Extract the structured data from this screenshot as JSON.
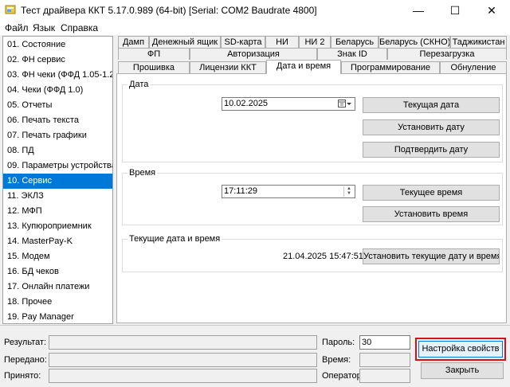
{
  "window": {
    "title": "Тест драйвера ККТ 5.17.0.989 (64-bit) [Serial: COM2 Baudrate 4800]",
    "minimize_glyph": "—",
    "maximize_glyph": "☐",
    "close_glyph": "✕"
  },
  "menu": {
    "file": "Файл",
    "language": "Язык",
    "help": "Справка"
  },
  "sidebar": {
    "items": [
      "01. Состояние",
      "02. ФН сервис",
      "03. ФН чеки (ФФД 1.05-1.2)",
      "04. Чеки (ФФД 1.0)",
      "05. Отчеты",
      "06. Печать текста",
      "07. Печать графики",
      "08. ПД",
      "09. Параметры устройства",
      "10. Сервис",
      "11. ЭКЛЗ",
      "12. МФП",
      "13. Купюроприемник",
      "14. MasterPay-K",
      "15. Модем",
      "16. БД чеков",
      "17. Онлайн платежи",
      "18. Прочее",
      "19. Pay Manager"
    ],
    "selected_index": 9
  },
  "tabs": {
    "row1": [
      "Дамп",
      "Денежный ящик",
      "SD-карта",
      "НИ",
      "НИ 2",
      "Беларусь",
      "Беларусь (СКНО)",
      "Таджикистан"
    ],
    "row2": [
      "ФП",
      "Авторизация",
      "Знак ID",
      "Перезагрузка"
    ],
    "row3": [
      "Прошивка",
      "Лицензии ККТ",
      "Дата и время",
      "Программирование",
      "Обнуление"
    ],
    "active": "Дата и время"
  },
  "date_group": {
    "label": "Дата",
    "value": "10.02.2025",
    "btn_current": "Текущая дата",
    "btn_set": "Установить дату",
    "btn_confirm": "Подтвердить дату"
  },
  "time_group": {
    "label": "Время",
    "value": "17:11:29",
    "btn_current": "Текущее время",
    "btn_set": "Установить время"
  },
  "current_group": {
    "label": "Текущие дата и время",
    "value": "21.04.2025  15:47:51",
    "btn_set": "Установить текущие дату и время"
  },
  "status": {
    "result_label": "Результат:",
    "sent_label": "Передано:",
    "received_label": "Принято:",
    "password_label": "Пароль:",
    "password_value": "30",
    "time_label": "Время:",
    "operator_label": "Оператор:",
    "btn_settings": "Настройка свойств",
    "btn_close": "Закрыть"
  },
  "colors": {
    "selection": "#0078d7",
    "highlight": "#d6101b"
  }
}
